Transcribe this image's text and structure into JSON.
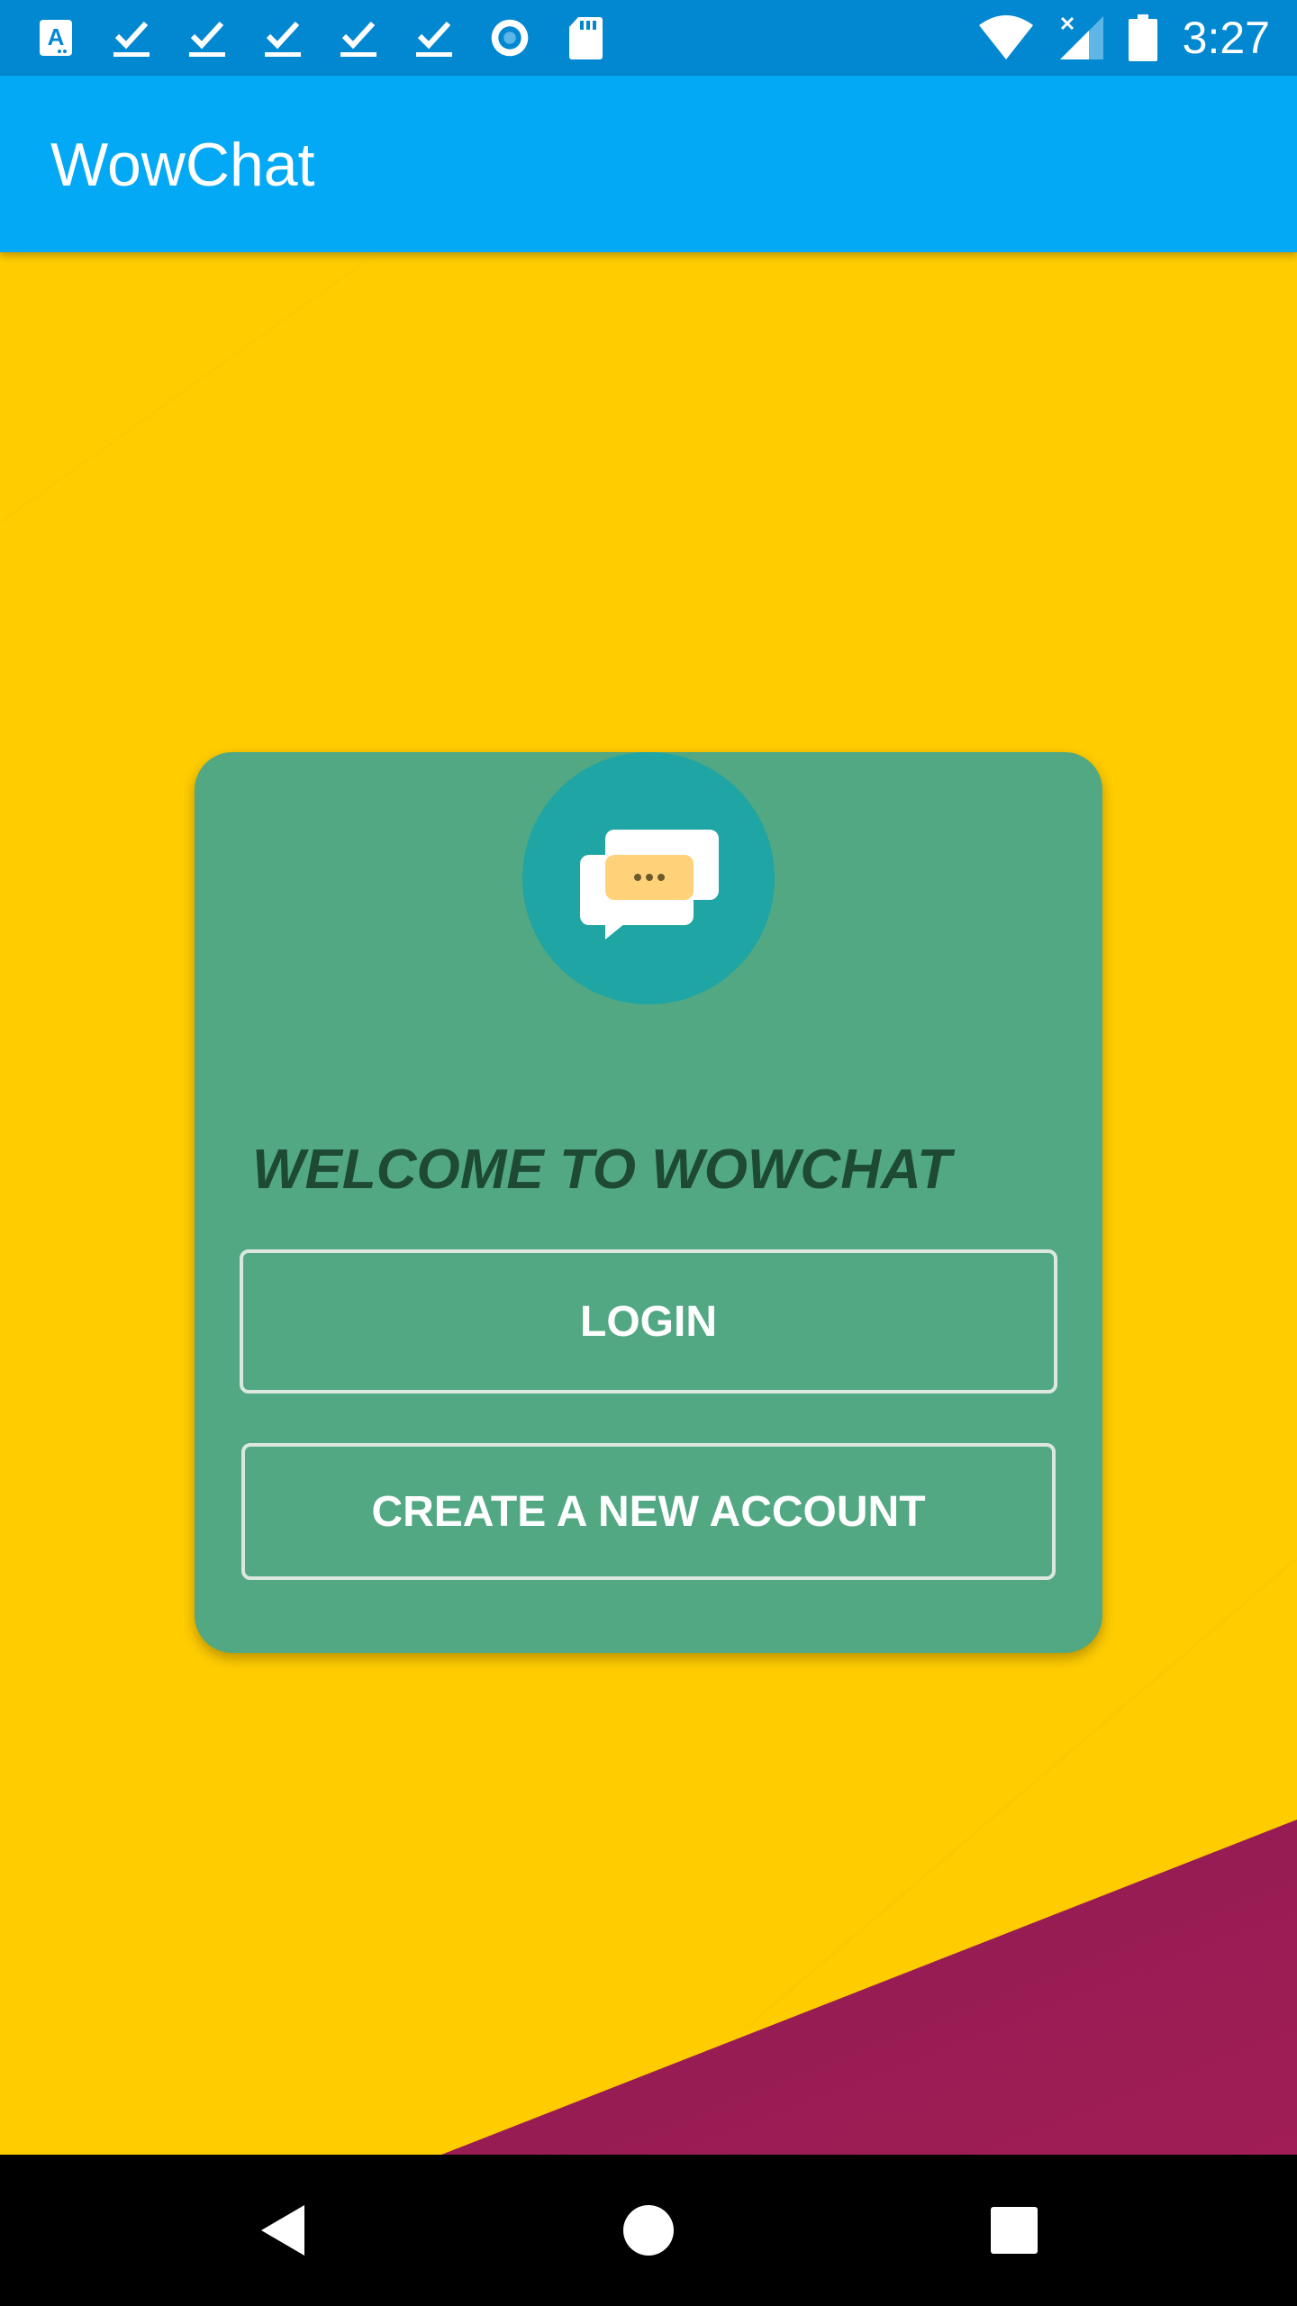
{
  "status_bar": {
    "time": "3:27",
    "left_icons": [
      "app-a-icon",
      "check-icon",
      "check-icon",
      "check-icon",
      "check-icon",
      "check-icon",
      "record-icon",
      "sd-card-icon"
    ],
    "right_icons": [
      "wifi-icon",
      "signal-no-data-icon",
      "battery-icon"
    ]
  },
  "app_bar": {
    "title": "WowChat"
  },
  "card": {
    "welcome": "WELCOME TO WOWCHAT",
    "login_label": "LOGIN",
    "create_label": "CREATE A NEW ACCOUNT",
    "logo_icon": "chat-bubbles-icon"
  },
  "nav_bar": {
    "icons": [
      "back-icon",
      "home-icon",
      "recents-icon"
    ]
  },
  "colors": {
    "status_bar": "#0288D1",
    "app_bar": "#03A9F4",
    "background": "#FFCC00",
    "card": "#52A882",
    "logo_circle": "#1FA5A4",
    "accent_corner": "#9C1D54"
  }
}
